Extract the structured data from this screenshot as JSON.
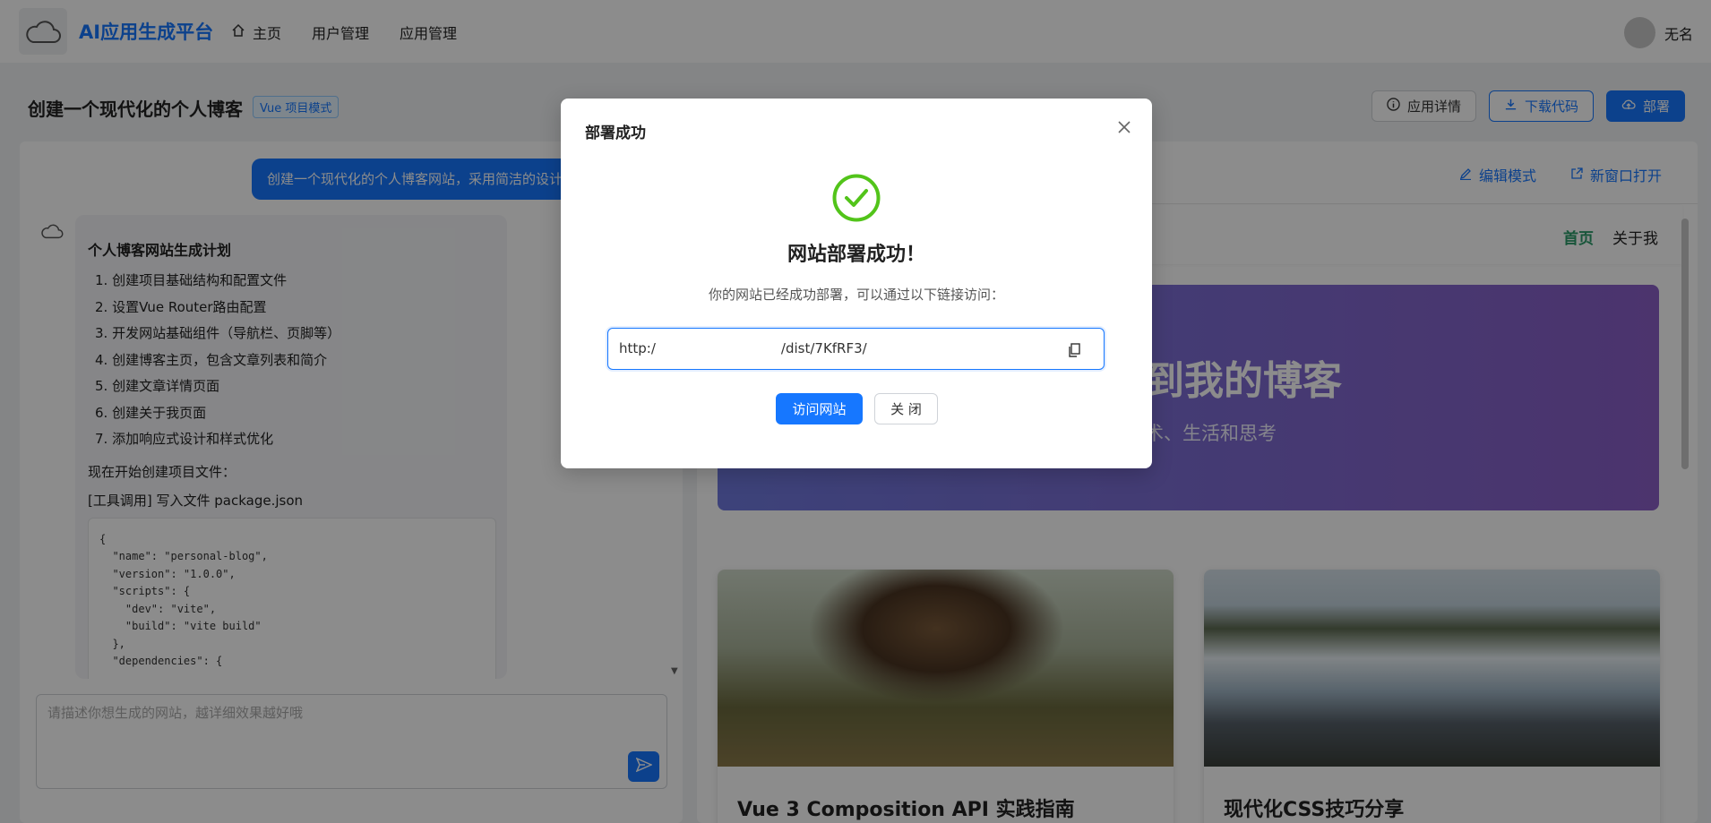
{
  "header": {
    "brand": "AI应用生成平台",
    "nav": [
      {
        "label": "主页",
        "icon": "home-icon"
      },
      {
        "label": "用户管理"
      },
      {
        "label": "应用管理"
      }
    ],
    "user_name": "无名"
  },
  "app": {
    "title": "创建一个现代化的个人博客",
    "mode_tag": "Vue 项目模式",
    "actions": {
      "details": "应用详情",
      "download": "下载代码",
      "deploy": "部署"
    }
  },
  "chat": {
    "user_message": "创建一个现代化的个人博客网站，采用简洁的设计",
    "plan_title": "个人博客网站生成计划",
    "steps": [
      "1. 创建项目基础结构和配置文件",
      "2. 设置Vue Router路由配置",
      "3. 开发网站基础组件（导航栏、页脚等）",
      "4. 创建博客主页，包含文章列表和简介",
      "5. 创建文章详情页面",
      "6. 创建关于我页面",
      "7. 添加响应式设计和样式优化"
    ],
    "start_text": "现在开始创建项目文件：",
    "tool_text": "[工具调用] 写入文件 package.json",
    "code_lines": [
      "{",
      "  \"name\": \"personal-blog\",",
      "  \"version\": \"1.0.0\",",
      "  \"scripts\": {",
      "    \"dev\": \"vite\",",
      "    \"build\": \"vite build\"",
      "  },",
      "  \"dependencies\": {"
    ],
    "input_placeholder": "请描述你想生成的网站，越详细效果越好哦"
  },
  "preview": {
    "edit_mode": "编辑模式",
    "open_new": "新窗口打开",
    "site_nav": {
      "home": "首页",
      "about": "关于我"
    },
    "hero_title": "到我的博客",
    "hero_subtitle": "术、生活和思考",
    "cards": [
      {
        "title": "Vue 3 Composition API 实践指南"
      },
      {
        "title": "现代化CSS技巧分享"
      }
    ]
  },
  "modal": {
    "title": "部署成功",
    "success_title": "网站部署成功！",
    "description": "你的网站已经成功部署，可以通过以下链接访问：",
    "url_prefix": "http:/",
    "url_suffix": "/dist/7KfRF3/",
    "visit_label": "访问网站",
    "close_label": "关 闭",
    "success_color": "#52c41a"
  }
}
